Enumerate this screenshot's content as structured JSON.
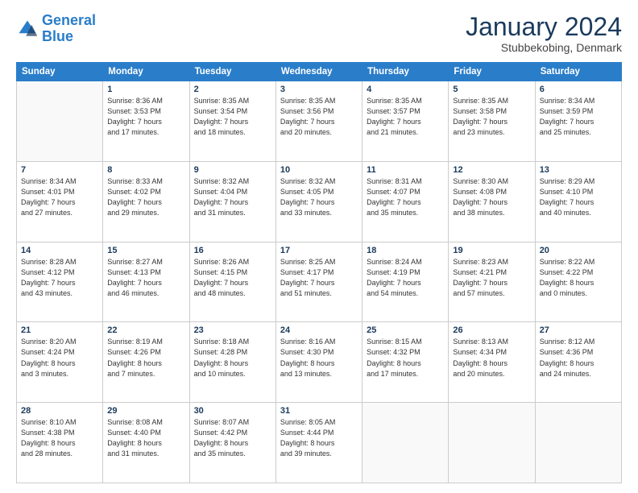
{
  "logo": {
    "line1": "General",
    "line2": "Blue"
  },
  "title": "January 2024",
  "subtitle": "Stubbekobing, Denmark",
  "days_of_week": [
    "Sunday",
    "Monday",
    "Tuesday",
    "Wednesday",
    "Thursday",
    "Friday",
    "Saturday"
  ],
  "weeks": [
    [
      {
        "num": "",
        "info": ""
      },
      {
        "num": "1",
        "info": "Sunrise: 8:36 AM\nSunset: 3:53 PM\nDaylight: 7 hours\nand 17 minutes."
      },
      {
        "num": "2",
        "info": "Sunrise: 8:35 AM\nSunset: 3:54 PM\nDaylight: 7 hours\nand 18 minutes."
      },
      {
        "num": "3",
        "info": "Sunrise: 8:35 AM\nSunset: 3:56 PM\nDaylight: 7 hours\nand 20 minutes."
      },
      {
        "num": "4",
        "info": "Sunrise: 8:35 AM\nSunset: 3:57 PM\nDaylight: 7 hours\nand 21 minutes."
      },
      {
        "num": "5",
        "info": "Sunrise: 8:35 AM\nSunset: 3:58 PM\nDaylight: 7 hours\nand 23 minutes."
      },
      {
        "num": "6",
        "info": "Sunrise: 8:34 AM\nSunset: 3:59 PM\nDaylight: 7 hours\nand 25 minutes."
      }
    ],
    [
      {
        "num": "7",
        "info": "Sunrise: 8:34 AM\nSunset: 4:01 PM\nDaylight: 7 hours\nand 27 minutes."
      },
      {
        "num": "8",
        "info": "Sunrise: 8:33 AM\nSunset: 4:02 PM\nDaylight: 7 hours\nand 29 minutes."
      },
      {
        "num": "9",
        "info": "Sunrise: 8:32 AM\nSunset: 4:04 PM\nDaylight: 7 hours\nand 31 minutes."
      },
      {
        "num": "10",
        "info": "Sunrise: 8:32 AM\nSunset: 4:05 PM\nDaylight: 7 hours\nand 33 minutes."
      },
      {
        "num": "11",
        "info": "Sunrise: 8:31 AM\nSunset: 4:07 PM\nDaylight: 7 hours\nand 35 minutes."
      },
      {
        "num": "12",
        "info": "Sunrise: 8:30 AM\nSunset: 4:08 PM\nDaylight: 7 hours\nand 38 minutes."
      },
      {
        "num": "13",
        "info": "Sunrise: 8:29 AM\nSunset: 4:10 PM\nDaylight: 7 hours\nand 40 minutes."
      }
    ],
    [
      {
        "num": "14",
        "info": "Sunrise: 8:28 AM\nSunset: 4:12 PM\nDaylight: 7 hours\nand 43 minutes."
      },
      {
        "num": "15",
        "info": "Sunrise: 8:27 AM\nSunset: 4:13 PM\nDaylight: 7 hours\nand 46 minutes."
      },
      {
        "num": "16",
        "info": "Sunrise: 8:26 AM\nSunset: 4:15 PM\nDaylight: 7 hours\nand 48 minutes."
      },
      {
        "num": "17",
        "info": "Sunrise: 8:25 AM\nSunset: 4:17 PM\nDaylight: 7 hours\nand 51 minutes."
      },
      {
        "num": "18",
        "info": "Sunrise: 8:24 AM\nSunset: 4:19 PM\nDaylight: 7 hours\nand 54 minutes."
      },
      {
        "num": "19",
        "info": "Sunrise: 8:23 AM\nSunset: 4:21 PM\nDaylight: 7 hours\nand 57 minutes."
      },
      {
        "num": "20",
        "info": "Sunrise: 8:22 AM\nSunset: 4:22 PM\nDaylight: 8 hours\nand 0 minutes."
      }
    ],
    [
      {
        "num": "21",
        "info": "Sunrise: 8:20 AM\nSunset: 4:24 PM\nDaylight: 8 hours\nand 3 minutes."
      },
      {
        "num": "22",
        "info": "Sunrise: 8:19 AM\nSunset: 4:26 PM\nDaylight: 8 hours\nand 7 minutes."
      },
      {
        "num": "23",
        "info": "Sunrise: 8:18 AM\nSunset: 4:28 PM\nDaylight: 8 hours\nand 10 minutes."
      },
      {
        "num": "24",
        "info": "Sunrise: 8:16 AM\nSunset: 4:30 PM\nDaylight: 8 hours\nand 13 minutes."
      },
      {
        "num": "25",
        "info": "Sunrise: 8:15 AM\nSunset: 4:32 PM\nDaylight: 8 hours\nand 17 minutes."
      },
      {
        "num": "26",
        "info": "Sunrise: 8:13 AM\nSunset: 4:34 PM\nDaylight: 8 hours\nand 20 minutes."
      },
      {
        "num": "27",
        "info": "Sunrise: 8:12 AM\nSunset: 4:36 PM\nDaylight: 8 hours\nand 24 minutes."
      }
    ],
    [
      {
        "num": "28",
        "info": "Sunrise: 8:10 AM\nSunset: 4:38 PM\nDaylight: 8 hours\nand 28 minutes."
      },
      {
        "num": "29",
        "info": "Sunrise: 8:08 AM\nSunset: 4:40 PM\nDaylight: 8 hours\nand 31 minutes."
      },
      {
        "num": "30",
        "info": "Sunrise: 8:07 AM\nSunset: 4:42 PM\nDaylight: 8 hours\nand 35 minutes."
      },
      {
        "num": "31",
        "info": "Sunrise: 8:05 AM\nSunset: 4:44 PM\nDaylight: 8 hours\nand 39 minutes."
      },
      {
        "num": "",
        "info": ""
      },
      {
        "num": "",
        "info": ""
      },
      {
        "num": "",
        "info": ""
      }
    ]
  ]
}
